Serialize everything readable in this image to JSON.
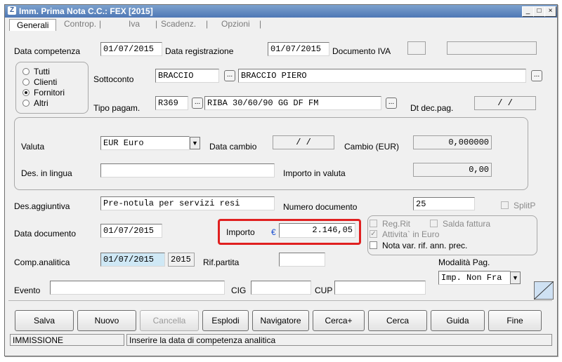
{
  "window": {
    "title": "Imm. Prima Nota C.C.: FEX [2015]",
    "minimize": "_",
    "maximize": "□",
    "close": "×"
  },
  "tabs": [
    "Generali",
    "Controp.",
    "Iva",
    "Scadenz.",
    "Opzioni"
  ],
  "form": {
    "data_competenza_label": "Data competenza",
    "data_competenza": "01/07/2015",
    "data_registrazione_label": "Data registrazione",
    "data_registrazione": "01/07/2015",
    "documento_iva_label": "Documento IVA",
    "radio": {
      "tutti": "Tutti",
      "clienti": "Clienti",
      "fornitori": "Fornitori",
      "altri": "Altri",
      "selected": "Fornitori"
    },
    "sottoconto_label": "Sottoconto",
    "sottoconto_code": "BRACCIO",
    "sottoconto_desc": "BRACCIO PIERO",
    "tipo_pagam_label": "Tipo pagam.",
    "tipo_pagam_code": "R369",
    "tipo_pagam_desc": "RIBA 30/60/90 GG DF FM",
    "dt_dec_pag_label": "Dt dec.pag.",
    "dt_dec_pag": "/ /",
    "dots": "...",
    "valuta_label": "Valuta",
    "valuta": "EUR Euro",
    "data_cambio_label": "Data cambio",
    "data_cambio": "/ /",
    "cambio_label": "Cambio (EUR)",
    "cambio": "0,000000",
    "des_lingua_label": "Des. in lingua",
    "importo_valuta_label": "Importo in valuta",
    "importo_valuta": "0,00",
    "des_aggiuntiva_label": "Des.aggiuntiva",
    "des_aggiuntiva": "Pre-notula per servizi resi",
    "numero_documento_label": "Numero documento",
    "numero_documento": "25",
    "splitp_label": "SplitP",
    "data_documento_label": "Data documento",
    "data_documento": "01/07/2015",
    "importo_label": "Importo",
    "euro_symbol": "€",
    "importo": "2.146,05",
    "reg_rit_label": "Reg.Rit",
    "salda_fattura_label": "Salda fattura",
    "attivita_euro_label": "Attivita` in Euro",
    "nota_var_label": "Nota var. rif. ann. prec.",
    "comp_analitica_label": "Comp.analitica",
    "comp_analitica": "01/07/2015",
    "comp_year": "2015",
    "rif_partita_label": "Rif.partita",
    "modalita_pag_label": "Modalità Pag.",
    "modalita_pag": "Imp. Non Fra",
    "evento_label": "Evento",
    "cig_label": "CIG",
    "cup_label": "CUP"
  },
  "buttons": [
    "Salva",
    "Nuovo",
    "Cancella",
    "Esplodi",
    "Navigatore",
    "Cerca+",
    "Cerca",
    "Guida",
    "Fine"
  ],
  "status": {
    "mode": "IMMISSIONE",
    "message": "Inserire la data di competenza analitica"
  }
}
